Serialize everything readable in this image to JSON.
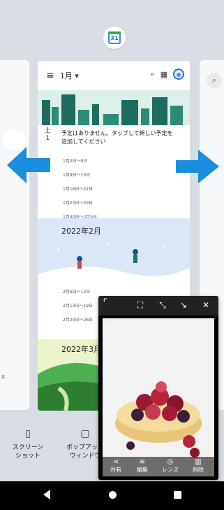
{
  "calendar_app": {
    "icon_number": "31",
    "toolbar": {
      "month": "1月 ▾"
    },
    "day": {
      "weekday": "土",
      "number": "1"
    },
    "empty_message": "予定はありません。タップして新しい予定を追加してください",
    "weeks_jan": [
      "1月2日～8日",
      "1月9日～15日",
      "1月16日～22日",
      "1月23日～29日",
      "1月30日～2月5日"
    ],
    "month2_label": "2022年2月",
    "weeks_feb": [
      "2月6日～12日",
      "2月13日～19日",
      "2月20日～26日"
    ],
    "month3_label": "2022年3月"
  },
  "bottom_buttons": {
    "screenshot": "スクリーン\nショット",
    "popup": "ポップアップ\nウィンドウ"
  },
  "photo_viewer": {
    "actions": [
      "共有",
      "編集",
      "レンズ",
      "削除"
    ]
  },
  "colors": {
    "arrow": "#1a8fe0",
    "calendar_blue": "#4285f4"
  }
}
